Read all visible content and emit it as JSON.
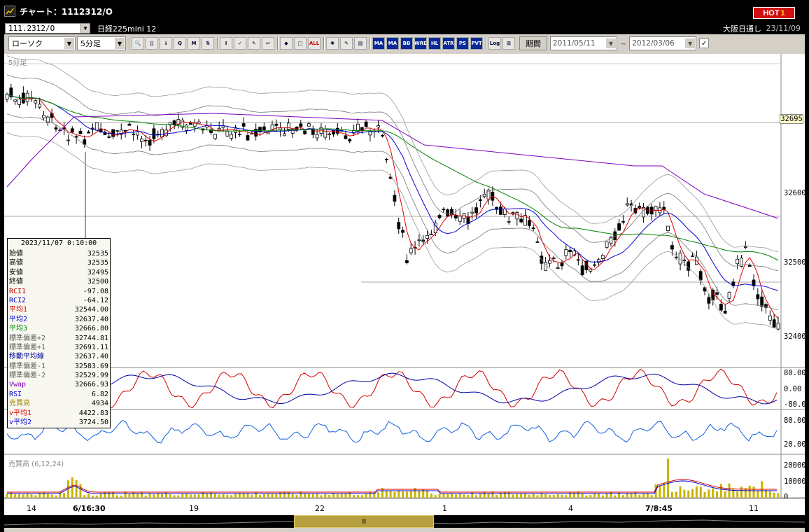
{
  "window": {
    "title": "チャート：1112312/O",
    "hot_label": "HOT",
    "hot_num": "1"
  },
  "infobar": {
    "symbol": "111.2312/O",
    "name": "日経225mini 12",
    "session": "大阪日通し",
    "date": "23/11/09"
  },
  "toolbar": {
    "chart_type": "ローソク",
    "interval": "5分足",
    "period_label": "期間",
    "date_from": "2011/05/11",
    "date_sep": "~",
    "date_to": "2012/03/06",
    "buttons": [
      "🔍",
      "||",
      "↓",
      "Q",
      "M",
      "⇅",
      "I",
      "✓",
      "↖",
      "↩",
      "◆",
      "□",
      "ALL",
      "✺",
      "✎",
      "▧",
      "MA",
      "MA",
      "BB",
      "WRE",
      "HL",
      "ATR",
      "PS",
      "PVT",
      "Log",
      "⊞"
    ]
  },
  "pane_main_label": "5分足",
  "current_price": "32695",
  "yaxis_main": [
    "32600",
    "32500",
    "32400"
  ],
  "yaxis_rsi": [
    "80.00",
    "0.00",
    "-80.00"
  ],
  "yaxis_osc": [
    "80.00",
    "20.00"
  ],
  "yaxis_vol": [
    "20000",
    "10000",
    "0"
  ],
  "pane_volume_label": "売買高 (6,12,24)",
  "xaxis": [
    {
      "label": "14",
      "bold": false
    },
    {
      "label": "6/16:30",
      "bold": true
    },
    {
      "label": "19",
      "bold": false
    },
    {
      "label": "22",
      "bold": false
    },
    {
      "label": "1",
      "bold": false
    },
    {
      "label": "4",
      "bold": false
    },
    {
      "label": "7/8:45",
      "bold": true
    },
    {
      "label": "11",
      "bold": false
    }
  ],
  "info": {
    "timestamp": "2023/11/07 0:10:00",
    "rows": [
      {
        "label": "始値",
        "value": "32535",
        "color": "#000"
      },
      {
        "label": "高値",
        "value": "32535",
        "color": "#000"
      },
      {
        "label": "安値",
        "value": "32495",
        "color": "#000"
      },
      {
        "label": "終値",
        "value": "32500",
        "color": "#000"
      },
      {
        "label": "RCI1",
        "value": "-97.08",
        "color": "#c00000"
      },
      {
        "label": "RCI2",
        "value": "-64.12",
        "color": "#0000c0"
      },
      {
        "label": "平均1",
        "value": "32544.00",
        "color": "#e00000"
      },
      {
        "label": "平均2",
        "value": "32637.40",
        "color": "#0000e0"
      },
      {
        "label": "平均3",
        "value": "32666.80",
        "color": "#008000"
      },
      {
        "label": "標準偏差+2",
        "value": "32744.81",
        "color": "#606060"
      },
      {
        "label": "標準偏差+1",
        "value": "32691.11",
        "color": "#606060"
      },
      {
        "label": "移動平均線",
        "value": "32637.40",
        "color": "#0000a0"
      },
      {
        "label": "標準偏差-1",
        "value": "32583.69",
        "color": "#606060"
      },
      {
        "label": "標準偏差-2",
        "value": "32529.99",
        "color": "#606060"
      },
      {
        "label": "Vwap",
        "value": "32666.93",
        "color": "#8000c0"
      },
      {
        "label": "RSI",
        "value": "6.82",
        "color": "#0000e0"
      },
      {
        "label": "売買高",
        "value": "4934",
        "color": "#a08000"
      },
      {
        "label": "v平均1",
        "value": "4422.83",
        "color": "#e00000"
      },
      {
        "label": "v平均2",
        "value": "3724.50",
        "color": "#0000e0"
      }
    ]
  }
}
